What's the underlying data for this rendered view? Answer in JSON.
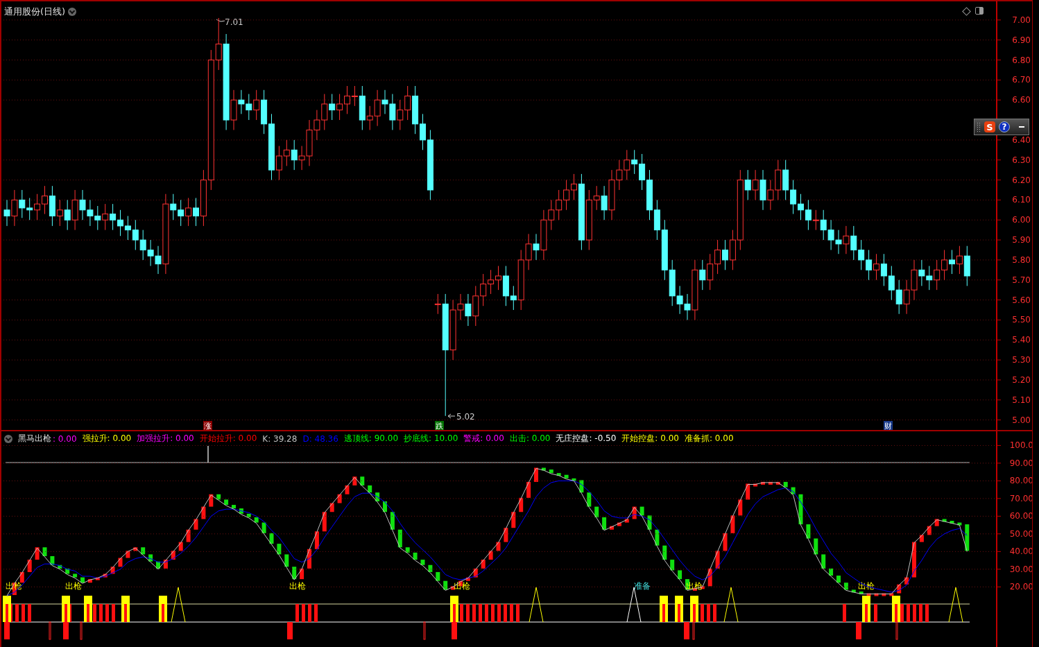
{
  "main_panel": {
    "title": "通用股份(日线)",
    "high_marker": "7.01",
    "low_marker": "5.02",
    "event_tags": [
      {
        "text": "涨",
        "color": "#8b0000"
      },
      {
        "text": "跌",
        "color": "#007000"
      },
      {
        "text": "财",
        "color": "#1a3c8c"
      }
    ],
    "chart_data": {
      "type": "candlestick",
      "ylim": [
        4.95,
        7.1
      ],
      "grid": true,
      "ohlc": [
        [
          6.05,
          6.1,
          5.97,
          6.02
        ],
        [
          6.02,
          6.15,
          5.97,
          6.1
        ],
        [
          6.1,
          6.15,
          6.01,
          6.06
        ],
        [
          6.06,
          6.11,
          6.0,
          6.05
        ],
        [
          6.05,
          6.13,
          6.0,
          6.08
        ],
        [
          6.08,
          6.17,
          6.03,
          6.12
        ],
        [
          6.12,
          6.17,
          5.97,
          6.02
        ],
        [
          6.02,
          6.1,
          5.97,
          6.05
        ],
        [
          6.05,
          6.1,
          5.95,
          6.0
        ],
        [
          6.0,
          6.15,
          5.95,
          6.1
        ],
        [
          6.1,
          6.15,
          6.0,
          6.05
        ],
        [
          6.05,
          6.1,
          5.97,
          6.02
        ],
        [
          6.02,
          6.07,
          5.95,
          6.0
        ],
        [
          6.0,
          6.08,
          5.95,
          6.03
        ],
        [
          6.03,
          6.08,
          5.95,
          6.0
        ],
        [
          6.0,
          6.05,
          5.92,
          5.97
        ],
        [
          5.97,
          6.02,
          5.9,
          5.95
        ],
        [
          5.95,
          6.0,
          5.85,
          5.9
        ],
        [
          5.9,
          5.95,
          5.8,
          5.85
        ],
        [
          5.85,
          5.9,
          5.77,
          5.82
        ],
        [
          5.82,
          5.87,
          5.73,
          5.78
        ],
        [
          5.78,
          6.13,
          5.73,
          6.08
        ],
        [
          6.08,
          6.13,
          6.0,
          6.05
        ],
        [
          6.05,
          6.1,
          5.97,
          6.02
        ],
        [
          6.02,
          6.11,
          5.97,
          6.06
        ],
        [
          6.06,
          6.11,
          5.97,
          6.02
        ],
        [
          6.02,
          6.25,
          5.97,
          6.2
        ],
        [
          6.2,
          6.85,
          6.15,
          6.8
        ],
        [
          6.8,
          7.01,
          6.75,
          6.88
        ],
        [
          6.88,
          6.93,
          6.45,
          6.5
        ],
        [
          6.5,
          6.65,
          6.45,
          6.6
        ],
        [
          6.6,
          6.65,
          6.53,
          6.58
        ],
        [
          6.58,
          6.63,
          6.5,
          6.55
        ],
        [
          6.55,
          6.65,
          6.5,
          6.6
        ],
        [
          6.6,
          6.65,
          6.43,
          6.48
        ],
        [
          6.48,
          6.53,
          6.2,
          6.25
        ],
        [
          6.25,
          6.37,
          6.2,
          6.32
        ],
        [
          6.32,
          6.4,
          6.27,
          6.35
        ],
        [
          6.35,
          6.4,
          6.25,
          6.3
        ],
        [
          6.3,
          6.37,
          6.25,
          6.32
        ],
        [
          6.32,
          6.5,
          6.27,
          6.45
        ],
        [
          6.45,
          6.55,
          6.4,
          6.5
        ],
        [
          6.5,
          6.63,
          6.45,
          6.58
        ],
        [
          6.58,
          6.63,
          6.5,
          6.55
        ],
        [
          6.55,
          6.63,
          6.5,
          6.58
        ],
        [
          6.58,
          6.67,
          6.53,
          6.62
        ],
        [
          6.62,
          6.67,
          6.57,
          6.62
        ],
        [
          6.62,
          6.67,
          6.45,
          6.5
        ],
        [
          6.5,
          6.57,
          6.45,
          6.52
        ],
        [
          6.52,
          6.65,
          6.47,
          6.6
        ],
        [
          6.6,
          6.65,
          6.53,
          6.58
        ],
        [
          6.58,
          6.63,
          6.45,
          6.5
        ],
        [
          6.5,
          6.6,
          6.45,
          6.55
        ],
        [
          6.55,
          6.67,
          6.5,
          6.62
        ],
        [
          6.62,
          6.67,
          6.43,
          6.48
        ],
        [
          6.48,
          6.53,
          6.35,
          6.4
        ],
        [
          6.4,
          6.45,
          6.1,
          6.15
        ],
        [
          5.58,
          5.63,
          5.53,
          5.58
        ],
        [
          5.58,
          5.63,
          5.02,
          5.35
        ],
        [
          5.35,
          5.6,
          5.3,
          5.55
        ],
        [
          5.55,
          5.63,
          5.5,
          5.58
        ],
        [
          5.58,
          5.63,
          5.47,
          5.52
        ],
        [
          5.52,
          5.67,
          5.47,
          5.62
        ],
        [
          5.62,
          5.73,
          5.57,
          5.68
        ],
        [
          5.68,
          5.75,
          5.63,
          5.7
        ],
        [
          5.7,
          5.77,
          5.65,
          5.72
        ],
        [
          5.72,
          5.77,
          5.57,
          5.62
        ],
        [
          5.62,
          5.67,
          5.55,
          5.6
        ],
        [
          5.6,
          5.85,
          5.55,
          5.8
        ],
        [
          5.8,
          5.93,
          5.75,
          5.88
        ],
        [
          5.88,
          5.93,
          5.8,
          5.85
        ],
        [
          5.85,
          6.05,
          5.8,
          6.0
        ],
        [
          6.0,
          6.1,
          5.95,
          6.05
        ],
        [
          6.05,
          6.15,
          6.0,
          6.1
        ],
        [
          6.1,
          6.2,
          6.05,
          6.15
        ],
        [
          6.15,
          6.23,
          6.1,
          6.18
        ],
        [
          6.18,
          6.23,
          5.85,
          5.9
        ],
        [
          5.9,
          6.15,
          5.85,
          6.1
        ],
        [
          6.1,
          6.17,
          6.05,
          6.12
        ],
        [
          6.12,
          6.17,
          6.0,
          6.05
        ],
        [
          6.05,
          6.25,
          6.0,
          6.2
        ],
        [
          6.2,
          6.3,
          6.15,
          6.25
        ],
        [
          6.25,
          6.35,
          6.2,
          6.3
        ],
        [
          6.3,
          6.35,
          6.23,
          6.28
        ],
        [
          6.28,
          6.33,
          6.15,
          6.2
        ],
        [
          6.2,
          6.25,
          6.0,
          6.05
        ],
        [
          6.05,
          6.1,
          5.9,
          5.95
        ],
        [
          5.95,
          6.0,
          5.7,
          5.75
        ],
        [
          5.75,
          5.8,
          5.57,
          5.62
        ],
        [
          5.62,
          5.67,
          5.53,
          5.58
        ],
        [
          5.58,
          5.63,
          5.5,
          5.55
        ],
        [
          5.55,
          5.8,
          5.5,
          5.75
        ],
        [
          5.75,
          5.8,
          5.65,
          5.7
        ],
        [
          5.7,
          5.83,
          5.65,
          5.78
        ],
        [
          5.78,
          5.9,
          5.73,
          5.85
        ],
        [
          5.85,
          5.9,
          5.75,
          5.8
        ],
        [
          5.8,
          5.95,
          5.75,
          5.9
        ],
        [
          5.9,
          6.25,
          5.85,
          6.2
        ],
        [
          6.2,
          6.25,
          6.1,
          6.15
        ],
        [
          6.15,
          6.25,
          6.1,
          6.2
        ],
        [
          6.2,
          6.25,
          6.05,
          6.1
        ],
        [
          6.1,
          6.2,
          6.05,
          6.15
        ],
        [
          6.15,
          6.3,
          6.1,
          6.25
        ],
        [
          6.25,
          6.3,
          6.1,
          6.15
        ],
        [
          6.15,
          6.2,
          6.03,
          6.08
        ],
        [
          6.08,
          6.13,
          6.0,
          6.05
        ],
        [
          6.05,
          6.1,
          5.95,
          6.0
        ],
        [
          6.0,
          6.05,
          5.95,
          6.0
        ],
        [
          6.0,
          6.05,
          5.9,
          5.95
        ],
        [
          5.95,
          6.0,
          5.85,
          5.9
        ],
        [
          5.9,
          5.95,
          5.83,
          5.88
        ],
        [
          5.88,
          5.97,
          5.83,
          5.92
        ],
        [
          5.92,
          5.97,
          5.8,
          5.85
        ],
        [
          5.85,
          5.9,
          5.75,
          5.8
        ],
        [
          5.8,
          5.85,
          5.7,
          5.75
        ],
        [
          5.75,
          5.83,
          5.7,
          5.78
        ],
        [
          5.78,
          5.83,
          5.67,
          5.72
        ],
        [
          5.72,
          5.77,
          5.6,
          5.65
        ],
        [
          5.65,
          5.7,
          5.53,
          5.58
        ],
        [
          5.58,
          5.7,
          5.53,
          5.65
        ],
        [
          5.65,
          5.8,
          5.6,
          5.75
        ],
        [
          5.75,
          5.8,
          5.67,
          5.72
        ],
        [
          5.72,
          5.77,
          5.65,
          5.7
        ],
        [
          5.7,
          5.8,
          5.65,
          5.75
        ],
        [
          5.75,
          5.85,
          5.7,
          5.8
        ],
        [
          5.8,
          5.85,
          5.73,
          5.78
        ],
        [
          5.78,
          5.87,
          5.73,
          5.82
        ],
        [
          5.82,
          5.87,
          5.67,
          5.72
        ]
      ],
      "yticks": [
        {
          "value": 7,
          "label": "7.00"
        },
        {
          "value": 6.9,
          "label": "6.90"
        },
        {
          "value": 6.8,
          "label": "6.80"
        },
        {
          "value": 6.7,
          "label": "6.70"
        },
        {
          "value": 6.6,
          "label": "6.60"
        },
        {
          "value": 6.4,
          "label": "6.40"
        },
        {
          "value": 6.3,
          "label": "6.30"
        },
        {
          "value": 6.2,
          "label": "6.20"
        },
        {
          "value": 6.1,
          "label": "6.10"
        },
        {
          "value": 6,
          "label": "6.00"
        },
        {
          "value": 5.9,
          "label": "5.90"
        },
        {
          "value": 5.8,
          "label": "5.80"
        },
        {
          "value": 5.7,
          "label": "5.70"
        },
        {
          "value": 5.6,
          "label": "5.60"
        },
        {
          "value": 5.5,
          "label": "5.50"
        },
        {
          "value": 5.4,
          "label": "5.40"
        },
        {
          "value": 5.3,
          "label": "5.30"
        },
        {
          "value": 5.2,
          "label": "5.20"
        },
        {
          "value": 5.1,
          "label": "5.10"
        },
        {
          "value": 5,
          "label": "5.00"
        }
      ]
    }
  },
  "floating_toolbar": {
    "logo": "S",
    "help": "?"
  },
  "indicator_panel": {
    "name": "黑马出枪",
    "legend": [
      {
        "text": ": 0.00",
        "color": "#ff00ff"
      },
      {
        "text": "强拉升: 0.00",
        "color": "#ffff00"
      },
      {
        "text": "加强拉升: 0.00",
        "color": "#ff00ff"
      },
      {
        "text": "开始拉升: 0.00",
        "color": "#ff0000"
      },
      {
        "text": "K: 39.28",
        "color": "#c0c0c0"
      },
      {
        "text": "D: 48.36",
        "color": "#0000ff"
      },
      {
        "text": "逃顶线: 90.00",
        "color": "#00ff00"
      },
      {
        "text": "抄底线: 10.00",
        "color": "#00ff00"
      },
      {
        "text": "警戒: 0.00",
        "color": "#ff00ff"
      },
      {
        "text": "出击: 0.00",
        "color": "#00ff00"
      },
      {
        "text": "无庄控盘: -0.50",
        "color": "#ffffff"
      },
      {
        "text": "开始控盘: 0.00",
        "color": "#ffff00"
      },
      {
        "text": "准备抓: 0.00",
        "color": "#ffff00"
      }
    ],
    "signal_labels": [
      {
        "text": "出枪",
        "kind": "fire"
      },
      {
        "text": "出枪",
        "kind": "fire"
      },
      {
        "text": "出枪",
        "kind": "fire"
      },
      {
        "text": "出枪",
        "kind": "fire"
      },
      {
        "text": "准备",
        "kind": "ready"
      },
      {
        "text": "出枪",
        "kind": "fire"
      },
      {
        "text": "出枪",
        "kind": "fire"
      }
    ],
    "chart_data": {
      "type": "line",
      "ylim": [
        -14,
        108
      ],
      "grid": true,
      "series": [
        {
          "color": "#c0c0c0",
          "values": [
            15,
            22,
            28,
            35,
            42,
            37,
            32,
            30,
            27,
            25,
            22,
            24,
            25,
            27,
            31,
            36,
            40,
            42,
            38,
            34,
            30,
            35,
            40,
            45,
            52,
            58,
            65,
            72,
            69,
            66,
            64,
            61,
            59,
            56,
            50,
            44,
            38,
            31,
            24,
            30,
            41,
            51,
            62,
            67,
            72,
            77,
            82,
            77,
            73,
            68,
            62,
            52,
            42,
            39,
            35,
            32,
            28,
            23,
            18,
            20,
            23,
            25,
            30,
            35,
            40,
            45,
            53,
            62,
            70,
            79,
            87,
            86,
            84,
            83,
            81,
            80,
            73,
            65,
            59,
            52,
            54,
            56,
            58,
            65,
            60,
            52,
            43,
            35,
            29,
            24,
            18,
            19,
            20,
            30,
            40,
            50,
            60,
            69,
            78,
            78,
            79,
            79,
            79,
            76,
            72,
            55,
            47,
            38,
            30,
            26,
            22,
            18,
            17,
            16,
            16,
            16,
            16,
            16,
            21,
            25,
            45,
            49,
            54,
            58,
            57,
            56,
            55,
            40
          ]
        },
        {
          "color": "#0000ff",
          "values": [
            15,
            17,
            21,
            26,
            31,
            33,
            33,
            32,
            30,
            29,
            26,
            26,
            25,
            26,
            28,
            30,
            34,
            36,
            37,
            36,
            34,
            34,
            36,
            39,
            43,
            48,
            54,
            60,
            63,
            64,
            64,
            63,
            62,
            60,
            57,
            52,
            48,
            42,
            36,
            34,
            36,
            41,
            48,
            54,
            60,
            66,
            71,
            73,
            73,
            71,
            68,
            63,
            56,
            50,
            45,
            41,
            37,
            32,
            27,
            25,
            24,
            25,
            26,
            29,
            33,
            37,
            42,
            49,
            56,
            63,
            71,
            76,
            79,
            80,
            80,
            80,
            78,
            74,
            69,
            63,
            60,
            59,
            59,
            61,
            60,
            58,
            53,
            47,
            41,
            35,
            30,
            26,
            24,
            26,
            31,
            37,
            45,
            53,
            61,
            67,
            71,
            73,
            75,
            76,
            74,
            68,
            61,
            53,
            46,
            39,
            34,
            28,
            25,
            22,
            20,
            19,
            18,
            17,
            18,
            21,
            29,
            35,
            42,
            47,
            50,
            52,
            53,
            49
          ]
        }
      ],
      "yticks": [
        {
          "value": 100,
          "label": "100.0"
        },
        {
          "value": 90,
          "label": "90.00"
        },
        {
          "value": 80,
          "label": "80.00"
        },
        {
          "value": 70,
          "label": "70.00"
        },
        {
          "value": 60,
          "label": "60.00"
        },
        {
          "value": 50,
          "label": "50.00"
        },
        {
          "value": 40,
          "label": "40.00"
        },
        {
          "value": 30,
          "label": "30.00"
        },
        {
          "value": 20,
          "label": "20.00"
        }
      ]
    }
  }
}
